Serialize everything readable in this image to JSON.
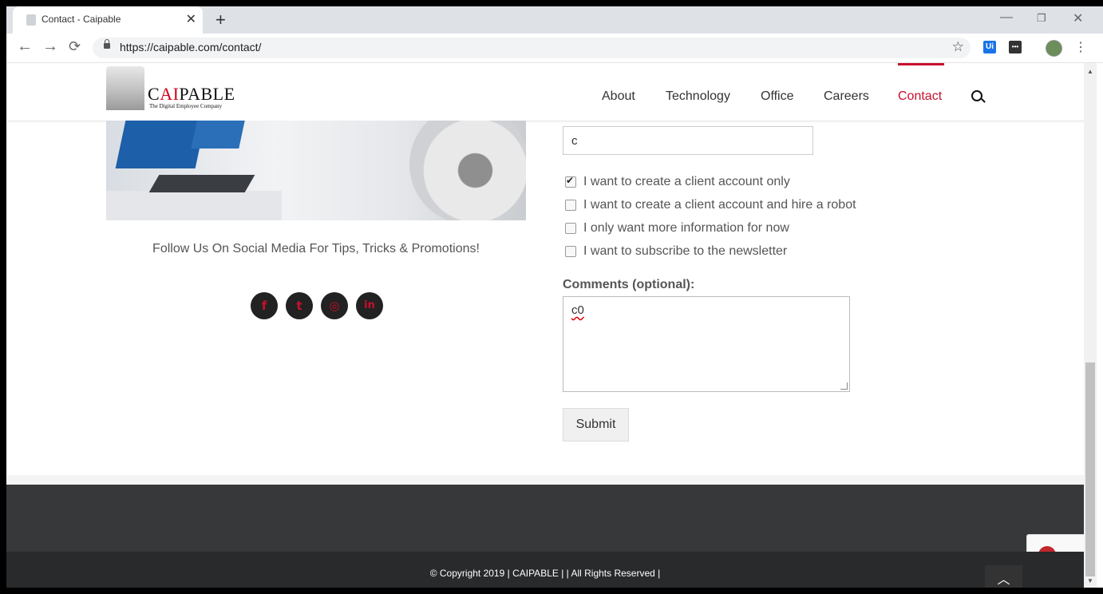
{
  "browser": {
    "tab_title": "Contact - Caipable",
    "tab_close": "✕",
    "new_tab": "+",
    "url": "https://caipable.com/contact/",
    "window_controls": {
      "minimize": "—",
      "restore": "❐",
      "close": "✕"
    },
    "nav": {
      "back": "←",
      "forward": "→",
      "reload": "⟳"
    },
    "bookmark": "☆",
    "extensions": [
      {
        "label": "Ui",
        "color": "#1a73e8"
      },
      {
        "label": "•••",
        "color": "#333333"
      }
    ],
    "menu": "⋮"
  },
  "site": {
    "logo": {
      "prefix": "C",
      "highlight": "AI",
      "suffix": "PABLE",
      "tagline": "The Digital Employee Company"
    },
    "nav": [
      "About",
      "Technology",
      "Office",
      "Careers",
      "Contact"
    ],
    "active_nav": "Contact",
    "accent_color": "#c8102e"
  },
  "left_column": {
    "social_heading": "Follow Us On Social Media For Tips, Tricks & Promotions!",
    "social_icons": [
      {
        "name": "facebook-icon",
        "glyph": "f"
      },
      {
        "name": "twitter-icon",
        "glyph": "t"
      },
      {
        "name": "instagram-icon",
        "glyph": "◎"
      },
      {
        "name": "linkedin-icon",
        "glyph": "in"
      }
    ]
  },
  "form": {
    "company_value": "c",
    "options": [
      {
        "label": "I want to create a client account only",
        "checked": true
      },
      {
        "label": "I want to create a client account and hire a robot",
        "checked": false
      },
      {
        "label": "I only want more information for now",
        "checked": false
      },
      {
        "label": "I want to subscribe to the newsletter",
        "checked": false
      }
    ],
    "comments_label": "Comments (optional):",
    "comments_value": "c0",
    "submit_label": "Submit"
  },
  "footer": {
    "copyright": "© Copyright 2019 | CAIPABLE | | All Rights Reserved |",
    "back_to_top": "︿"
  }
}
